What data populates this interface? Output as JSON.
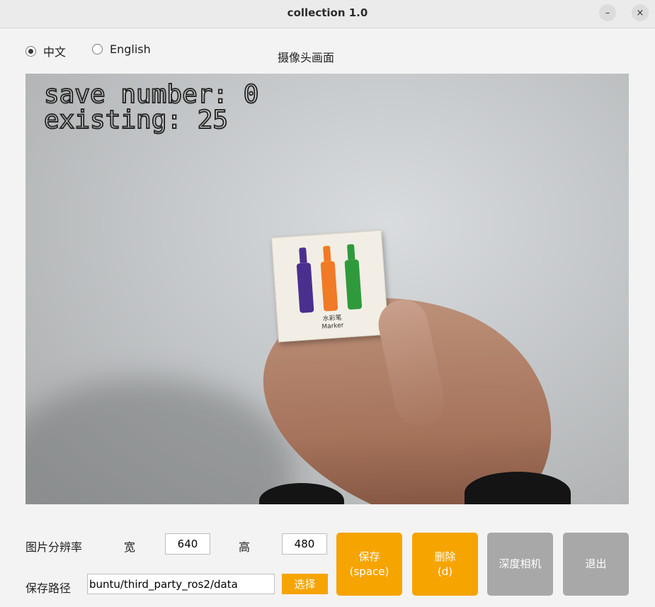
{
  "window": {
    "title": "collection 1.0",
    "minimize_glyph": "–",
    "close_glyph": "×"
  },
  "language": {
    "options": [
      {
        "label": "中文",
        "selected": true
      },
      {
        "label": "English",
        "selected": false
      }
    ]
  },
  "camera": {
    "title": "摄像头画面",
    "overlay_line1": "save number: 0",
    "overlay_line2": "existing: 25",
    "card_text_cn": "水彩笔",
    "card_text_en": "Marker"
  },
  "resolution": {
    "label": "图片分辨率",
    "width_label": "宽",
    "width_value": "640",
    "height_label": "高",
    "height_value": "480"
  },
  "save_path": {
    "label": "保存路径",
    "value": "buntu/third_party_ros2/data",
    "choose_label": "选择"
  },
  "buttons": {
    "save": {
      "label": "保存",
      "hint": "(space)"
    },
    "delete": {
      "label": "删除",
      "hint": "(d)"
    },
    "depth_camera": {
      "label": "深度相机"
    },
    "exit": {
      "label": "退出"
    }
  },
  "colors": {
    "accent": "#f6a400",
    "disabled": "#a8a8a8"
  }
}
